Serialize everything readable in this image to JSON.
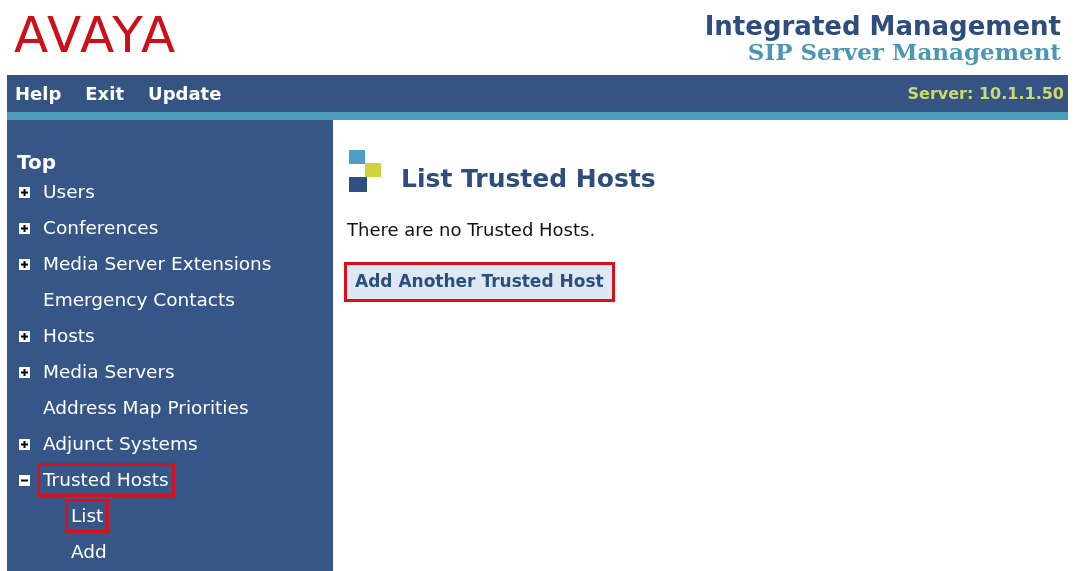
{
  "header": {
    "logo": "AVAYA",
    "title": "Integrated Management",
    "subtitle": "SIP Server Management"
  },
  "nav": {
    "links": [
      "Help",
      "Exit",
      "Update"
    ],
    "server": "Server: 10.1.1.50"
  },
  "sidebar": {
    "heading": "Top",
    "items": [
      {
        "label": "Users",
        "kind": "folder",
        "expanded": false,
        "highlighted": false
      },
      {
        "label": "Conferences",
        "kind": "folder",
        "expanded": false,
        "highlighted": false
      },
      {
        "label": "Media Server Extensions",
        "kind": "folder",
        "expanded": false,
        "highlighted": false
      },
      {
        "label": "Emergency Contacts",
        "kind": "leaf",
        "highlighted": false
      },
      {
        "label": "Hosts",
        "kind": "folder",
        "expanded": false,
        "highlighted": false
      },
      {
        "label": "Media Servers",
        "kind": "folder",
        "expanded": false,
        "highlighted": false
      },
      {
        "label": "Address Map Priorities",
        "kind": "leaf",
        "highlighted": false
      },
      {
        "label": "Adjunct Systems",
        "kind": "folder",
        "expanded": false,
        "highlighted": false
      },
      {
        "label": "Trusted Hosts",
        "kind": "folder",
        "expanded": true,
        "highlighted": true,
        "children": [
          {
            "label": "List",
            "highlighted": true
          },
          {
            "label": "Add",
            "highlighted": false
          }
        ]
      }
    ]
  },
  "content": {
    "heading": "List Trusted Hosts",
    "message": "There are no Trusted Hosts.",
    "action": {
      "label": "Add Another Trusted Host",
      "highlighted": true
    }
  }
}
